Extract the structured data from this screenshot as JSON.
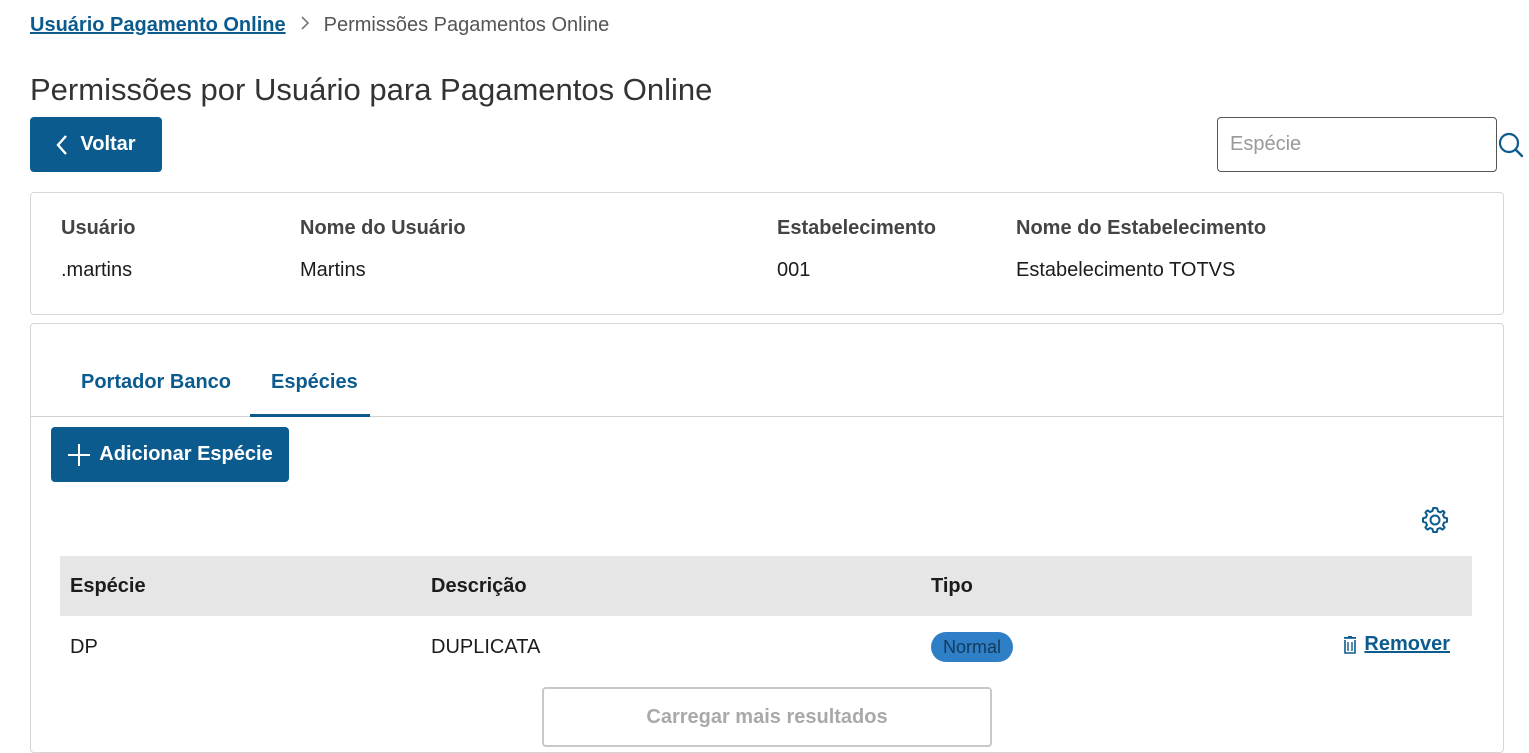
{
  "breadcrumb": {
    "parent": "Usuário Pagamento Online",
    "current": "Permissões Pagamentos Online"
  },
  "page_title": "Permissões por Usuário para Pagamentos Online",
  "actions": {
    "back_label": "Voltar",
    "search_placeholder": "Espécie",
    "search_value": ""
  },
  "info": {
    "labels": {
      "user": "Usuário",
      "user_name": "Nome do Usuário",
      "establishment": "Estabelecimento",
      "establishment_name": "Nome do Estabelecimento"
    },
    "values": {
      "user": ".martins",
      "user_name": "Martins",
      "establishment": "001",
      "establishment_name": "Estabelecimento TOTVS"
    }
  },
  "tabs": [
    {
      "label": "Portador Banco",
      "active": false
    },
    {
      "label": "Espécies",
      "active": true
    }
  ],
  "add_button_label": "Adicionar Espécie",
  "table": {
    "columns": [
      "Espécie",
      "Descrição",
      "Tipo"
    ],
    "rows": [
      {
        "especie": "DP",
        "descricao": "DUPLICATA",
        "tipo": "Normal",
        "action": "Remover"
      }
    ]
  },
  "load_more_label": "Carregar mais resultados",
  "colors": {
    "primary": "#0c5b8f",
    "badge": "#2f7fc7",
    "header_bg": "#e6e6e6"
  },
  "icons": [
    "chevron-right-icon",
    "chevron-left-icon",
    "search-icon",
    "plus-icon",
    "gear-icon",
    "trash-icon"
  ]
}
